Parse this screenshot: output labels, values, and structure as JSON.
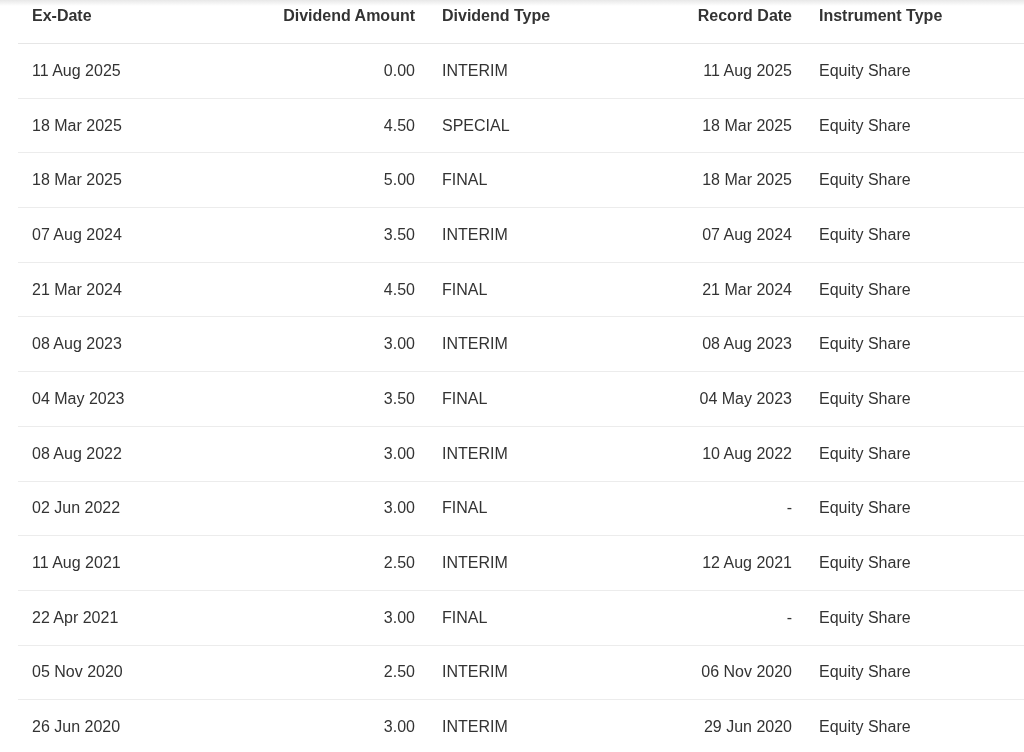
{
  "table": {
    "columns": [
      {
        "label": "Ex-Date",
        "numeric": false
      },
      {
        "label": "Dividend Amount",
        "numeric": true
      },
      {
        "label": "Dividend Type",
        "numeric": false
      },
      {
        "label": "Record Date",
        "numeric": true
      },
      {
        "label": "Instrument Type",
        "numeric": false
      }
    ],
    "rows": [
      [
        "11 Aug 2025",
        "0.00",
        "INTERIM",
        "11 Aug 2025",
        "Equity Share"
      ],
      [
        "18 Mar 2025",
        "4.50",
        "SPECIAL",
        "18 Mar 2025",
        "Equity Share"
      ],
      [
        "18 Mar 2025",
        "5.00",
        "FINAL",
        "18 Mar 2025",
        "Equity Share"
      ],
      [
        "07 Aug 2024",
        "3.50",
        "INTERIM",
        "07 Aug 2024",
        "Equity Share"
      ],
      [
        "21 Mar 2024",
        "4.50",
        "FINAL",
        "21 Mar 2024",
        "Equity Share"
      ],
      [
        "08 Aug 2023",
        "3.00",
        "INTERIM",
        "08 Aug 2023",
        "Equity Share"
      ],
      [
        "04 May 2023",
        "3.50",
        "FINAL",
        "04 May 2023",
        "Equity Share"
      ],
      [
        "08 Aug 2022",
        "3.00",
        "INTERIM",
        "10 Aug 2022",
        "Equity Share"
      ],
      [
        "02 Jun 2022",
        "3.00",
        "FINAL",
        "-",
        "Equity Share"
      ],
      [
        "11 Aug 2021",
        "2.50",
        "INTERIM",
        "12 Aug 2021",
        "Equity Share"
      ],
      [
        "22 Apr 2021",
        "3.00",
        "FINAL",
        "-",
        "Equity Share"
      ],
      [
        "05 Nov 2020",
        "2.50",
        "INTERIM",
        "06 Nov 2020",
        "Equity Share"
      ],
      [
        "26 Jun 2020",
        "3.00",
        "INTERIM",
        "29 Jun 2020",
        "Equity Share"
      ]
    ]
  }
}
